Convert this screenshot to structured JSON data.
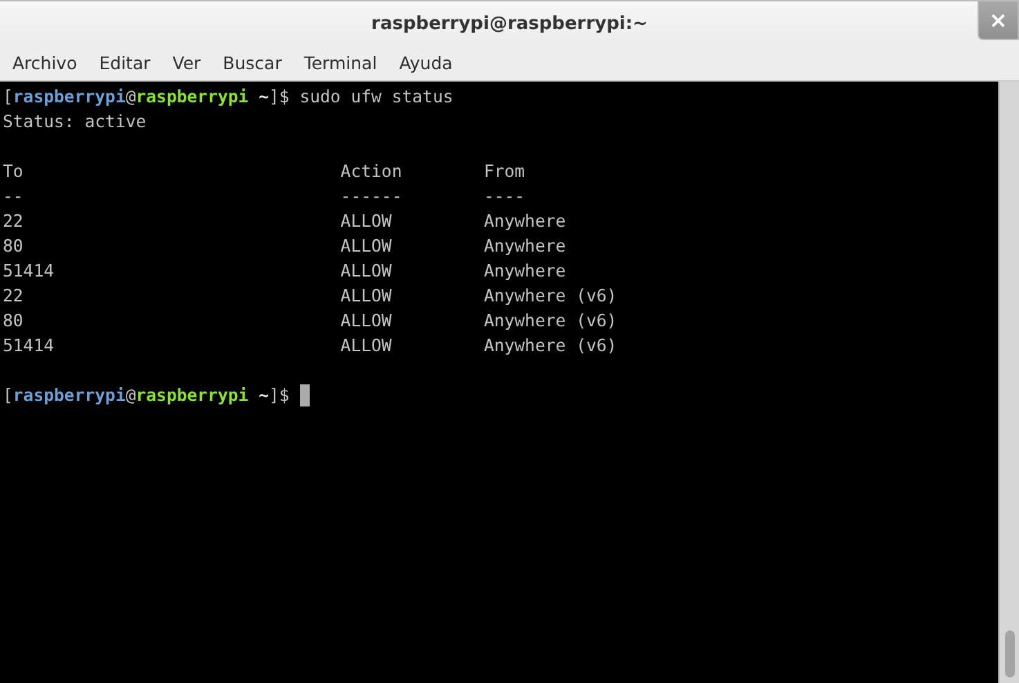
{
  "window": {
    "title": "raspberrypi@raspberrypi:~",
    "close": "×"
  },
  "menu": [
    "Archivo",
    "Editar",
    "Ver",
    "Buscar",
    "Terminal",
    "Ayuda"
  ],
  "terminal": {
    "command_prompt": [
      {
        "kind": "plain",
        "text": "["
      },
      {
        "kind": "user",
        "text": "raspberrypi"
      },
      {
        "kind": "plain",
        "text": "@"
      },
      {
        "kind": "host",
        "text": "raspberrypi"
      },
      {
        "kind": "dir",
        "text": " ~"
      },
      {
        "kind": "plain",
        "text": "]$ "
      }
    ],
    "command": "sudo ufw status",
    "status_line": "Status: active",
    "table": {
      "columns": [
        "To",
        "Action",
        "From"
      ],
      "rows": [
        [
          "--",
          "------",
          "----"
        ],
        [
          "22",
          "ALLOW",
          "Anywhere"
        ],
        [
          "80",
          "ALLOW",
          "Anywhere"
        ],
        [
          "51414",
          "ALLOW",
          "Anywhere"
        ],
        [
          "22",
          "ALLOW",
          "Anywhere (v6)"
        ],
        [
          "80",
          "ALLOW",
          "Anywhere (v6)"
        ],
        [
          "51414",
          "ALLOW",
          "Anywhere (v6)"
        ]
      ]
    },
    "final_prompt": [
      {
        "kind": "plain",
        "text": "["
      },
      {
        "kind": "user",
        "text": "raspberrypi"
      },
      {
        "kind": "plain",
        "text": "@"
      },
      {
        "kind": "host",
        "text": "raspberrypi"
      },
      {
        "kind": "dir",
        "text": " ~"
      },
      {
        "kind": "plain",
        "text": "]$ "
      }
    ]
  }
}
